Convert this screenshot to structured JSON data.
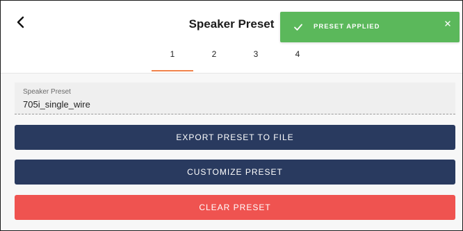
{
  "header": {
    "title": "Speaker Preset",
    "back_icon": "chevron-left-icon",
    "tabs": [
      {
        "label": "1",
        "active": true
      },
      {
        "label": "2",
        "active": false
      },
      {
        "label": "3",
        "active": false
      },
      {
        "label": "4",
        "active": false
      }
    ]
  },
  "preset_field": {
    "label": "Speaker Preset",
    "value": "705i_single_wire"
  },
  "buttons": {
    "export_label": "EXPORT PRESET TO FILE",
    "customize_label": "CUSTOMIZE PRESET",
    "clear_label": "CLEAR PRESET"
  },
  "toast": {
    "message": "PRESET APPLIED",
    "icon": "check-icon",
    "close_icon": "close-icon"
  },
  "colors": {
    "primary_button": "#293a5f",
    "danger_button": "#ef5350",
    "toast_success": "#5bb85b",
    "tab_indicator": "#f0824a"
  }
}
